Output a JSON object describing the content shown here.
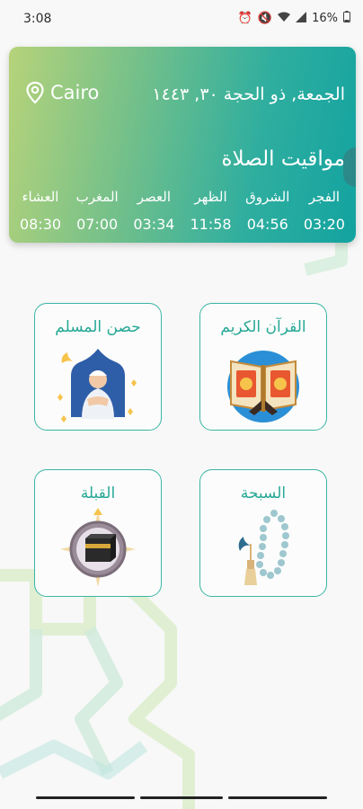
{
  "status_bar": {
    "time": "3:08",
    "battery": "16%"
  },
  "prayer_card": {
    "location": "Cairo",
    "date": "الجمعة, ذو الحجة ٣٠, ١٤٤٣",
    "title": "مواقيت الصلاة",
    "prayers": [
      {
        "name": "الفجر",
        "time": "03:20"
      },
      {
        "name": "الشروق",
        "time": "04:56"
      },
      {
        "name": "الظهر",
        "time": "11:58"
      },
      {
        "name": "العصر",
        "time": "03:34"
      },
      {
        "name": "المغرب",
        "time": "07:00"
      },
      {
        "name": "العشاء",
        "time": "08:30"
      }
    ]
  },
  "tiles": {
    "quran": "القرآن الكريم",
    "hisn": "حصن المسلم",
    "tasbih": "السبحة",
    "qibla": "القبلة"
  },
  "colors": {
    "accent": "#27a896",
    "card_start": "#b6d37a",
    "card_end": "#13a3a0"
  }
}
